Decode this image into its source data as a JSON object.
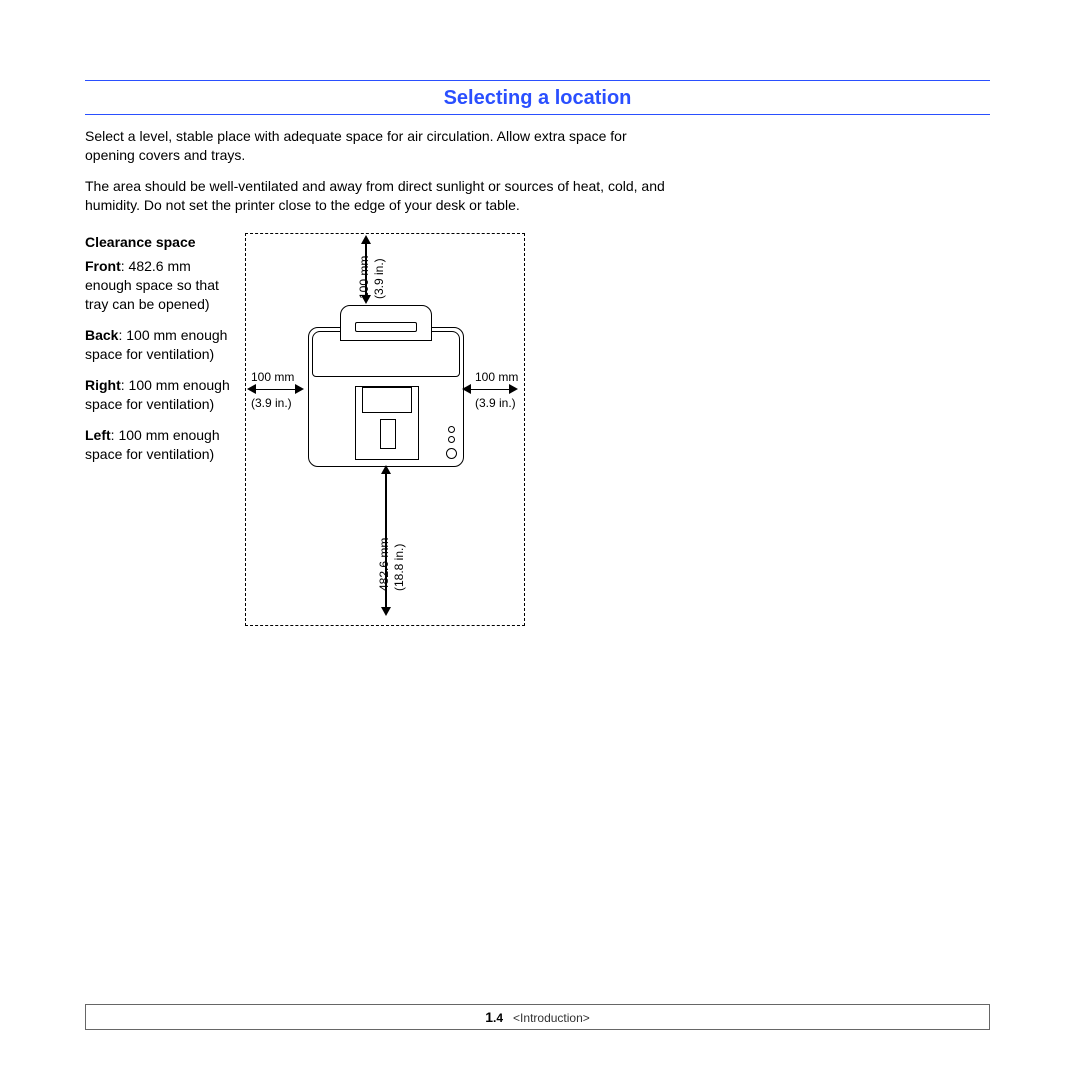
{
  "section": {
    "title": "Selecting a location",
    "para1": "Select a level, stable place with adequate space for air circulation. Allow extra space for opening covers and trays.",
    "para2": "The area should be well-ventilated and away from direct sunlight or sources of heat, cold, and humidity. Do not set the printer close to the edge of your desk or table."
  },
  "clearance": {
    "heading": "Clearance space",
    "front_lead": "Front",
    "front_rest": ": 482.6 mm enough space so that tray can be opened)",
    "back_lead": "Back",
    "back_rest": ": 100 mm enough space for ventilation)",
    "right_lead": "Right",
    "right_rest": ": 100 mm enough space for ventilation)",
    "left_lead": "Left",
    "left_rest": ": 100 mm enough space for ventilation)"
  },
  "diagram": {
    "top_mm": "100 mm",
    "top_in": "(3.9 in.)",
    "left_mm": "100 mm",
    "left_in": "(3.9 in.)",
    "right_mm": "100 mm",
    "right_in": "(3.9 in.)",
    "front_mm": "482.6 mm",
    "front_in": "(18.8 in.)"
  },
  "footer": {
    "page_major": "1",
    "page_minor": ".4",
    "chapter": "<Introduction>"
  }
}
